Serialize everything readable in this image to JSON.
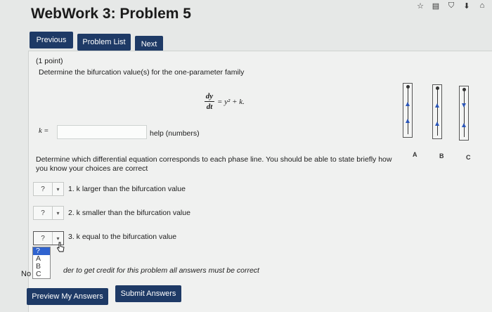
{
  "toolbar_icons": [
    "star-icon",
    "bookmark-icon",
    "shield-icon",
    "download-icon",
    "home-icon"
  ],
  "title": "WebWork 3: Problem 5",
  "nav": {
    "previous": "Previous",
    "problem_list": "Problem List",
    "next": "Next"
  },
  "problem": {
    "points": "(1 point)",
    "prompt": "Determine the bifurcation value(s) for the one-parameter family",
    "eq_num": "dy",
    "eq_den": "dt",
    "eq_rhs": "= y² + k.",
    "k_label": "k =",
    "k_value": "",
    "help": "help (numbers)",
    "instruction_line1": "Determine which differential equation corresponds to each phase line. You should be able to state briefly how",
    "instruction_line2": "you know your choices are correct"
  },
  "phase_lines": {
    "labels": [
      "A",
      "B",
      "C"
    ]
  },
  "questions": [
    {
      "select_value": "?",
      "text": "1. k larger than the bifurcation value"
    },
    {
      "select_value": "?",
      "text": "2. k smaller than the bifurcation value"
    },
    {
      "select_value": "?",
      "text": "3. k equal to the bifurcation value"
    }
  ],
  "dropdown_options": [
    "?",
    "A",
    "B",
    "C"
  ],
  "note_prefix": "No",
  "note_text": "der to get credit for this problem all answers must be correct",
  "actions": {
    "preview": "Preview My Answers",
    "submit": "Submit Answers"
  },
  "colors": {
    "button_bg": "#1e3a66",
    "arrow": "#2a55b8",
    "select_highlight": "#2f63cf"
  }
}
